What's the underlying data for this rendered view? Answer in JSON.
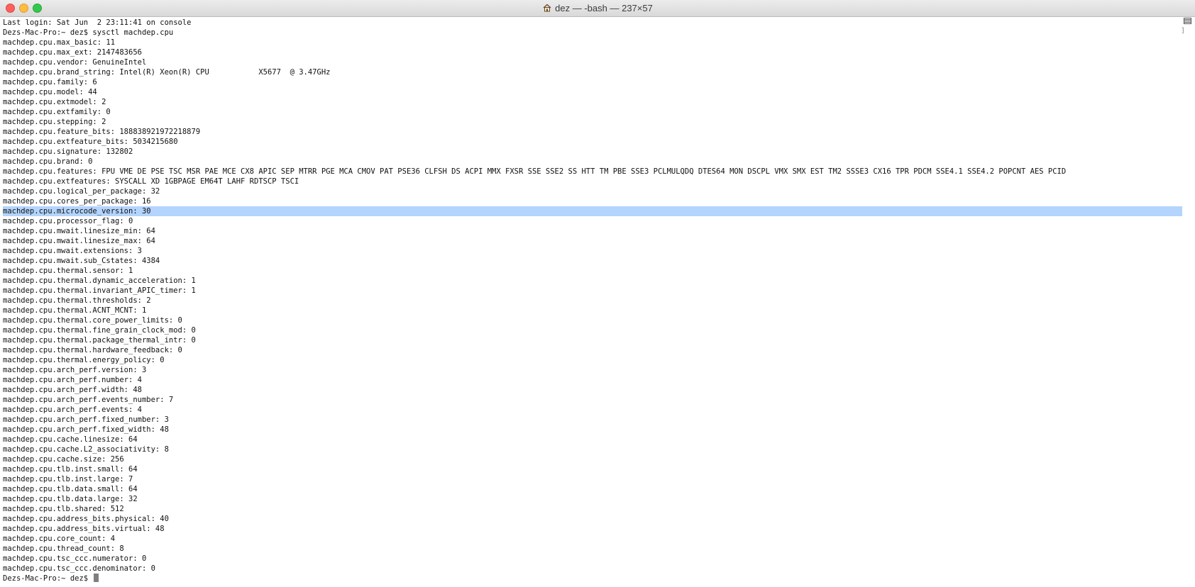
{
  "window": {
    "title": "dez — -bash — 237×57",
    "title_icon": "home-icon"
  },
  "terminal": {
    "lines": [
      "Last login: Sat Jun  2 23:11:41 on console",
      "Dezs-Mac-Pro:~ dez$ sysctl machdep.cpu",
      "machdep.cpu.max_basic: 11",
      "machdep.cpu.max_ext: 2147483656",
      "machdep.cpu.vendor: GenuineIntel",
      "machdep.cpu.brand_string: Intel(R) Xeon(R) CPU           X5677  @ 3.47GHz",
      "machdep.cpu.family: 6",
      "machdep.cpu.model: 44",
      "machdep.cpu.extmodel: 2",
      "machdep.cpu.extfamily: 0",
      "machdep.cpu.stepping: 2",
      "machdep.cpu.feature_bits: 188838921972218879",
      "machdep.cpu.extfeature_bits: 5034215680",
      "machdep.cpu.signature: 132802",
      "machdep.cpu.brand: 0",
      "machdep.cpu.features: FPU VME DE PSE TSC MSR PAE MCE CX8 APIC SEP MTRR PGE MCA CMOV PAT PSE36 CLFSH DS ACPI MMX FXSR SSE SSE2 SS HTT TM PBE SSE3 PCLMULQDQ DTES64 MON DSCPL VMX SMX EST TM2 SSSE3 CX16 TPR PDCM SSE4.1 SSE4.2 POPCNT AES PCID",
      "machdep.cpu.extfeatures: SYSCALL XD 1GBPAGE EM64T LAHF RDTSCP TSCI",
      "machdep.cpu.logical_per_package: 32",
      "machdep.cpu.cores_per_package: 16",
      "machdep.cpu.microcode_version: 30",
      "machdep.cpu.processor_flag: 0",
      "machdep.cpu.mwait.linesize_min: 64",
      "machdep.cpu.mwait.linesize_max: 64",
      "machdep.cpu.mwait.extensions: 3",
      "machdep.cpu.mwait.sub_Cstates: 4384",
      "machdep.cpu.thermal.sensor: 1",
      "machdep.cpu.thermal.dynamic_acceleration: 1",
      "machdep.cpu.thermal.invariant_APIC_timer: 1",
      "machdep.cpu.thermal.thresholds: 2",
      "machdep.cpu.thermal.ACNT_MCNT: 1",
      "machdep.cpu.thermal.core_power_limits: 0",
      "machdep.cpu.thermal.fine_grain_clock_mod: 0",
      "machdep.cpu.thermal.package_thermal_intr: 0",
      "machdep.cpu.thermal.hardware_feedback: 0",
      "machdep.cpu.thermal.energy_policy: 0",
      "machdep.cpu.arch_perf.version: 3",
      "machdep.cpu.arch_perf.number: 4",
      "machdep.cpu.arch_perf.width: 48",
      "machdep.cpu.arch_perf.events_number: 7",
      "machdep.cpu.arch_perf.events: 4",
      "machdep.cpu.arch_perf.fixed_number: 3",
      "machdep.cpu.arch_perf.fixed_width: 48",
      "machdep.cpu.cache.linesize: 64",
      "machdep.cpu.cache.L2_associativity: 8",
      "machdep.cpu.cache.size: 256",
      "machdep.cpu.tlb.inst.small: 64",
      "machdep.cpu.tlb.inst.large: 7",
      "machdep.cpu.tlb.data.small: 64",
      "machdep.cpu.tlb.data.large: 32",
      "machdep.cpu.tlb.shared: 512",
      "machdep.cpu.address_bits.physical: 40",
      "machdep.cpu.address_bits.virtual: 48",
      "machdep.cpu.core_count: 4",
      "machdep.cpu.thread_count: 8",
      "machdep.cpu.tsc_ccc.numerator: 0",
      "machdep.cpu.tsc_ccc.denominator: 0"
    ],
    "selected_line": 19,
    "prompt": "Dezs-Mac-Pro:~ dez$ "
  },
  "scrollbar": {
    "bracket": "]"
  },
  "colors": {
    "selection": "#b3d4fc",
    "text": "#111111",
    "close": "#fc605c",
    "minimize": "#fdbc40",
    "zoom": "#34c84a"
  }
}
